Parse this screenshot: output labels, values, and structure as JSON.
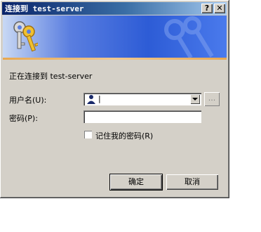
{
  "window": {
    "title": "连接到 test-server",
    "help_label": "?",
    "close_label": "✕"
  },
  "banner": {
    "icon": "keys-icon"
  },
  "message": "正在连接到 test-server",
  "username": {
    "label": "用户名(U):",
    "value": "|",
    "user_icon": "user-icon",
    "browse_label": "..."
  },
  "password": {
    "label": "密码(P):",
    "value": ""
  },
  "remember": {
    "label": "记住我的密码(R)",
    "checked": false
  },
  "buttons": {
    "ok": "确定",
    "cancel": "取消"
  }
}
